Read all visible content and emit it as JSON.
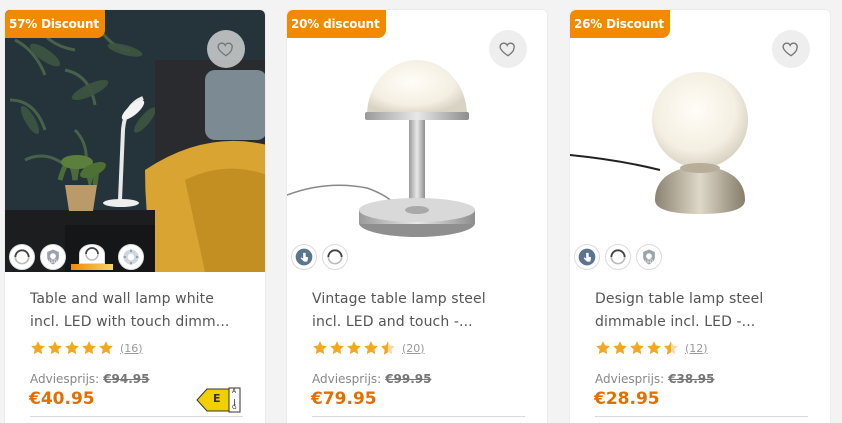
{
  "products": [
    {
      "badge": "57% Discount",
      "title_line1": "Table and wall lamp white",
      "title_line2": "incl. LED with touch dimm...",
      "rating": 5,
      "review_count": "(16)",
      "advice_label": "Adviesprijs:",
      "old_price": "€94.95",
      "price": "€40.95",
      "energy_class": "E",
      "energy_scale_top": "A",
      "energy_scale_bottom": "G",
      "features": [
        "dimmable-icon",
        "led-included-icon",
        "dimmer-icon",
        "color-temperature-icon"
      ]
    },
    {
      "badge": "20% discount",
      "title_line1": "Vintage table lamp steel",
      "title_line2": "incl. LED and touch -...",
      "rating": 4.5,
      "review_count": "(20)",
      "advice_label": "Adviesprijs:",
      "old_price": "€99.95",
      "price": "€79.95",
      "features": [
        "touch-icon",
        "dimmable-icon"
      ]
    },
    {
      "badge": "26% Discount",
      "title_line1": "Design table lamp steel",
      "title_line2": "dimmable incl. LED -...",
      "rating": 4.5,
      "review_count": "(12)",
      "advice_label": "Adviesprijs:",
      "old_price": "€38.95",
      "price": "€28.95",
      "features": [
        "touch-icon",
        "dimmable-icon",
        "led-included-icon"
      ]
    }
  ],
  "colors": {
    "accent": "#f18a00",
    "price": "#e46f00",
    "star": "#f5a623"
  }
}
